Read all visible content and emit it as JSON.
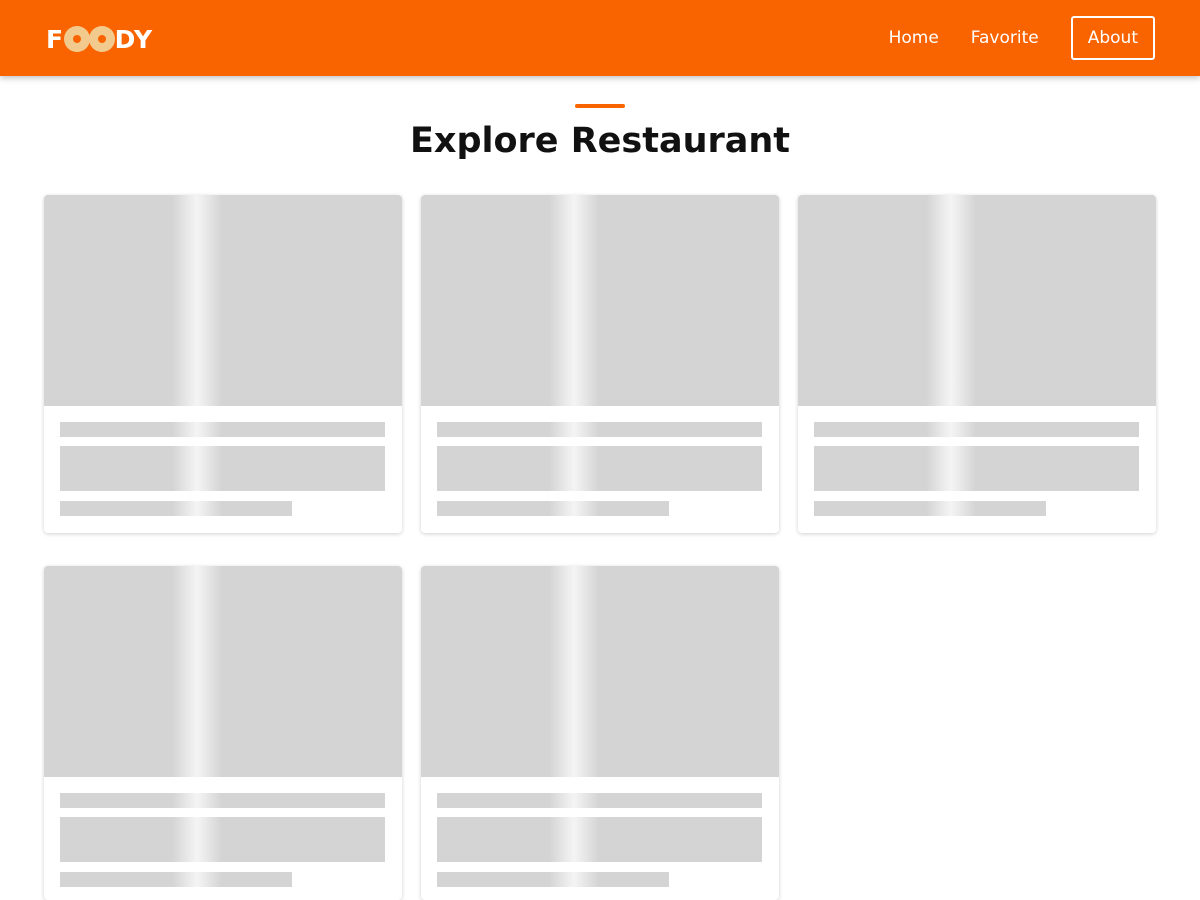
{
  "header": {
    "brand": {
      "prefix": "F",
      "suffix": "DY",
      "logo_icon": "donut-icon",
      "full_text": "FOODY"
    },
    "nav": [
      {
        "label": "Home"
      },
      {
        "label": "Favorite"
      },
      {
        "label": "About"
      }
    ]
  },
  "main": {
    "title": "Explore Restaurant",
    "cards": [
      {
        "state": "loading-skeleton"
      },
      {
        "state": "loading-skeleton"
      },
      {
        "state": "loading-skeleton"
      },
      {
        "state": "loading-skeleton"
      },
      {
        "state": "loading-skeleton"
      }
    ]
  },
  "colors": {
    "brand": "#f96400",
    "logo_accent": "#f3ca8e",
    "skeleton": "#d4d4d4",
    "title_text": "#111111"
  }
}
